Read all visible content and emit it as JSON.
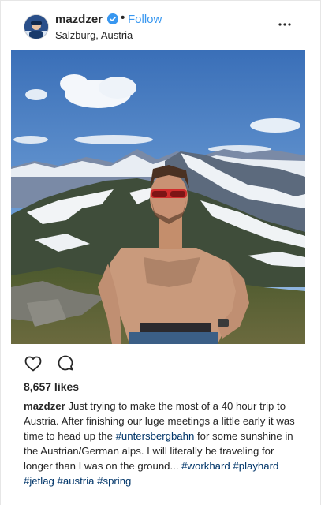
{
  "post": {
    "username": "mazdzer",
    "separator": "•",
    "follow_label": "Follow",
    "location": "Salzburg, Austria",
    "likes": "8,657 likes"
  },
  "caption": {
    "user": "mazdzer",
    "t1": " Just trying to make the most of a 40 hour trip to Austria. After finishing our luge meetings a little early it was time to head up the ",
    "tag1": "#untersbergbahn",
    "t2": " for some sunshine in the Austrian/German alps. I will literally be traveling for longer than I was on the ground... ",
    "tag2": "#workhard",
    "tag3": "#playhard",
    "tag4": "#jetlag",
    "tag5": "#austria",
    "tag6": "#spring"
  },
  "colors": {
    "link_blue": "#3897f0",
    "hashtag": "#003569",
    "text": "#262626"
  },
  "icons": [
    "verified-badge-icon",
    "more-options-icon",
    "heart-icon",
    "comment-icon"
  ]
}
